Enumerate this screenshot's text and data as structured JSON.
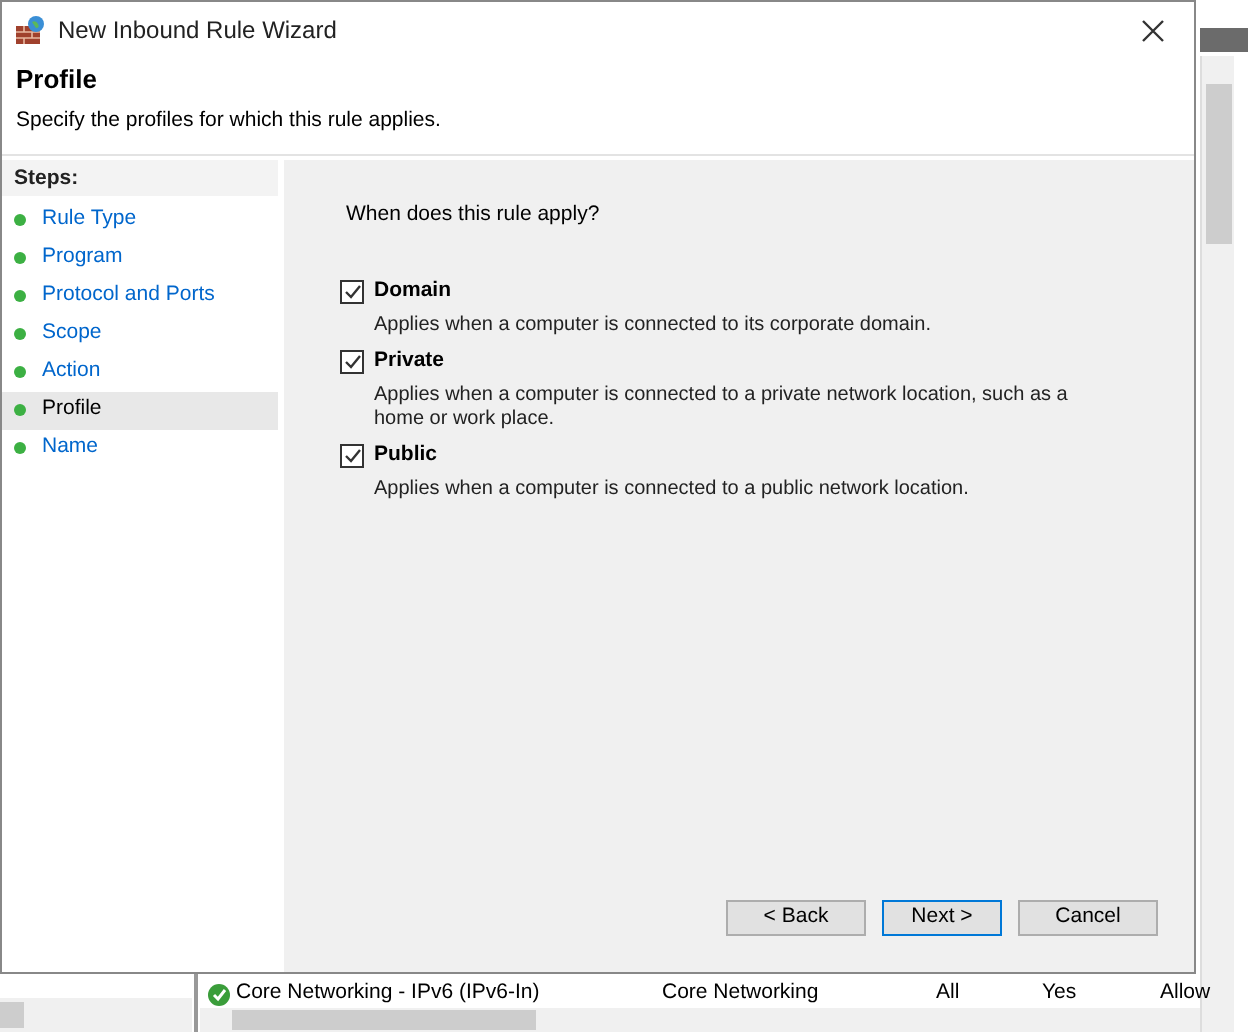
{
  "window": {
    "title": "New Inbound Rule Wizard"
  },
  "header": {
    "title": "Profile",
    "subtitle": "Specify the profiles for which this rule applies."
  },
  "steps": {
    "heading": "Steps:",
    "items": [
      {
        "label": "Rule Type",
        "selected": false
      },
      {
        "label": "Program",
        "selected": false
      },
      {
        "label": "Protocol and Ports",
        "selected": false
      },
      {
        "label": "Scope",
        "selected": false
      },
      {
        "label": "Action",
        "selected": false
      },
      {
        "label": "Profile",
        "selected": true
      },
      {
        "label": "Name",
        "selected": false
      }
    ]
  },
  "question": "When does this rule apply?",
  "profiles": [
    {
      "label": "Domain",
      "description": "Applies when a computer is connected to its corporate domain.",
      "checked": true
    },
    {
      "label": "Private",
      "description": "Applies when a computer is connected to a private network location, such as a home or work place.",
      "checked": true
    },
    {
      "label": "Public",
      "description": "Applies when a computer is connected to a public network location.",
      "checked": true
    }
  ],
  "buttons": [
    {
      "label": "< Back",
      "default": false
    },
    {
      "label": "Next >",
      "default": true
    },
    {
      "label": "Cancel",
      "default": false
    }
  ],
  "background_app": {
    "rows": [
      {
        "enabled": true,
        "cells": [
          "Core Networking - IPv6 (IPv6-In)",
          "Core Networking",
          "All",
          "Yes",
          "Allow"
        ]
      }
    ]
  }
}
